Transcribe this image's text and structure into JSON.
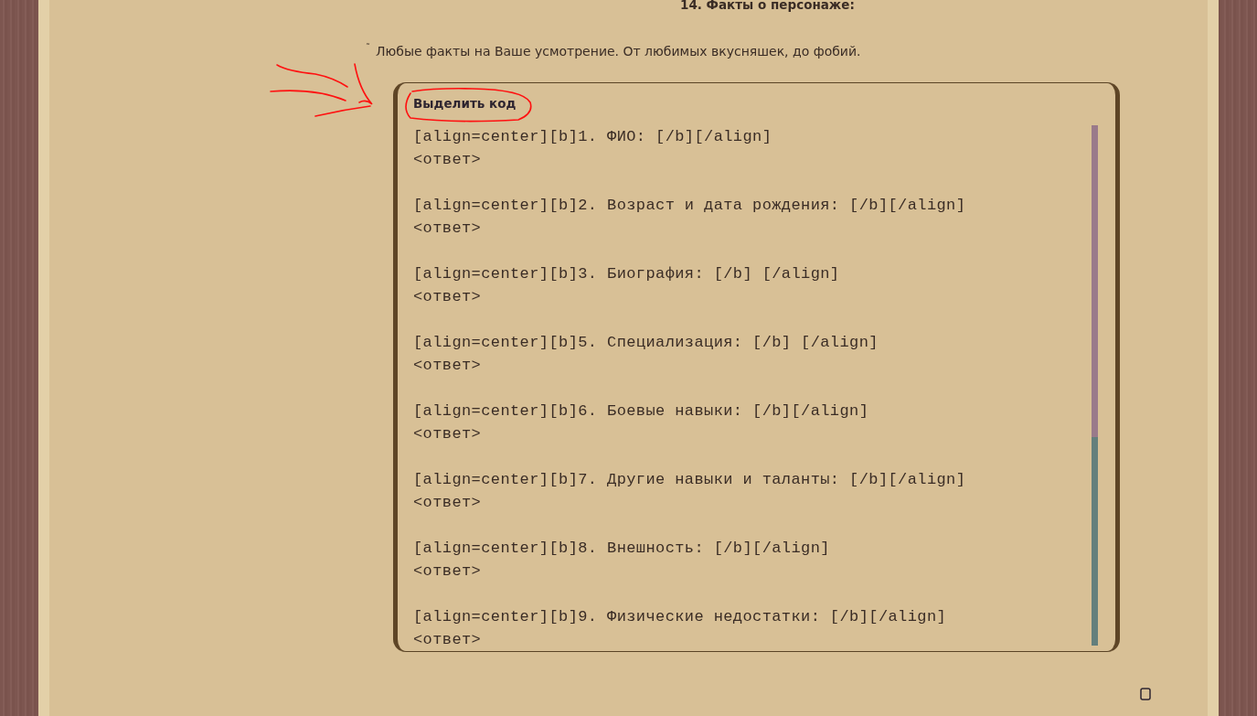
{
  "heading": "14. Факты о персонаже:",
  "quote": {
    "mark": "˜",
    "text": "Любые факты на Ваше усмотрение. От любимых вкусняшек, до фобий."
  },
  "code_box": {
    "title": "Выделить код",
    "blocks": [
      {
        "line": "[align=center][b]1. ФИО: [/b][/align]",
        "answer": "<ответ>"
      },
      {
        "line": "[align=center][b]2. Возраст и дата рождения: [/b][/align]",
        "answer": "<ответ>"
      },
      {
        "line": "[align=center][b]3. Биография: [/b] [/align]",
        "answer": "<ответ>"
      },
      {
        "line": "[align=center][b]5. Специализация: [/b] [/align]",
        "answer": "<ответ>"
      },
      {
        "line": "[align=center][b]6. Боевые навыки: [/b][/align]",
        "answer": "<ответ>"
      },
      {
        "line": "[align=center][b]7. Другие навыки и таланты: [/b][/align]",
        "answer": "<ответ>"
      },
      {
        "line": "[align=center][b]8. Внешность: [/b][/align]",
        "answer": "<ответ>"
      },
      {
        "line": "[align=center][b]9. Физические недостатки: [/b][/align]",
        "answer": "<ответ>"
      }
    ]
  }
}
